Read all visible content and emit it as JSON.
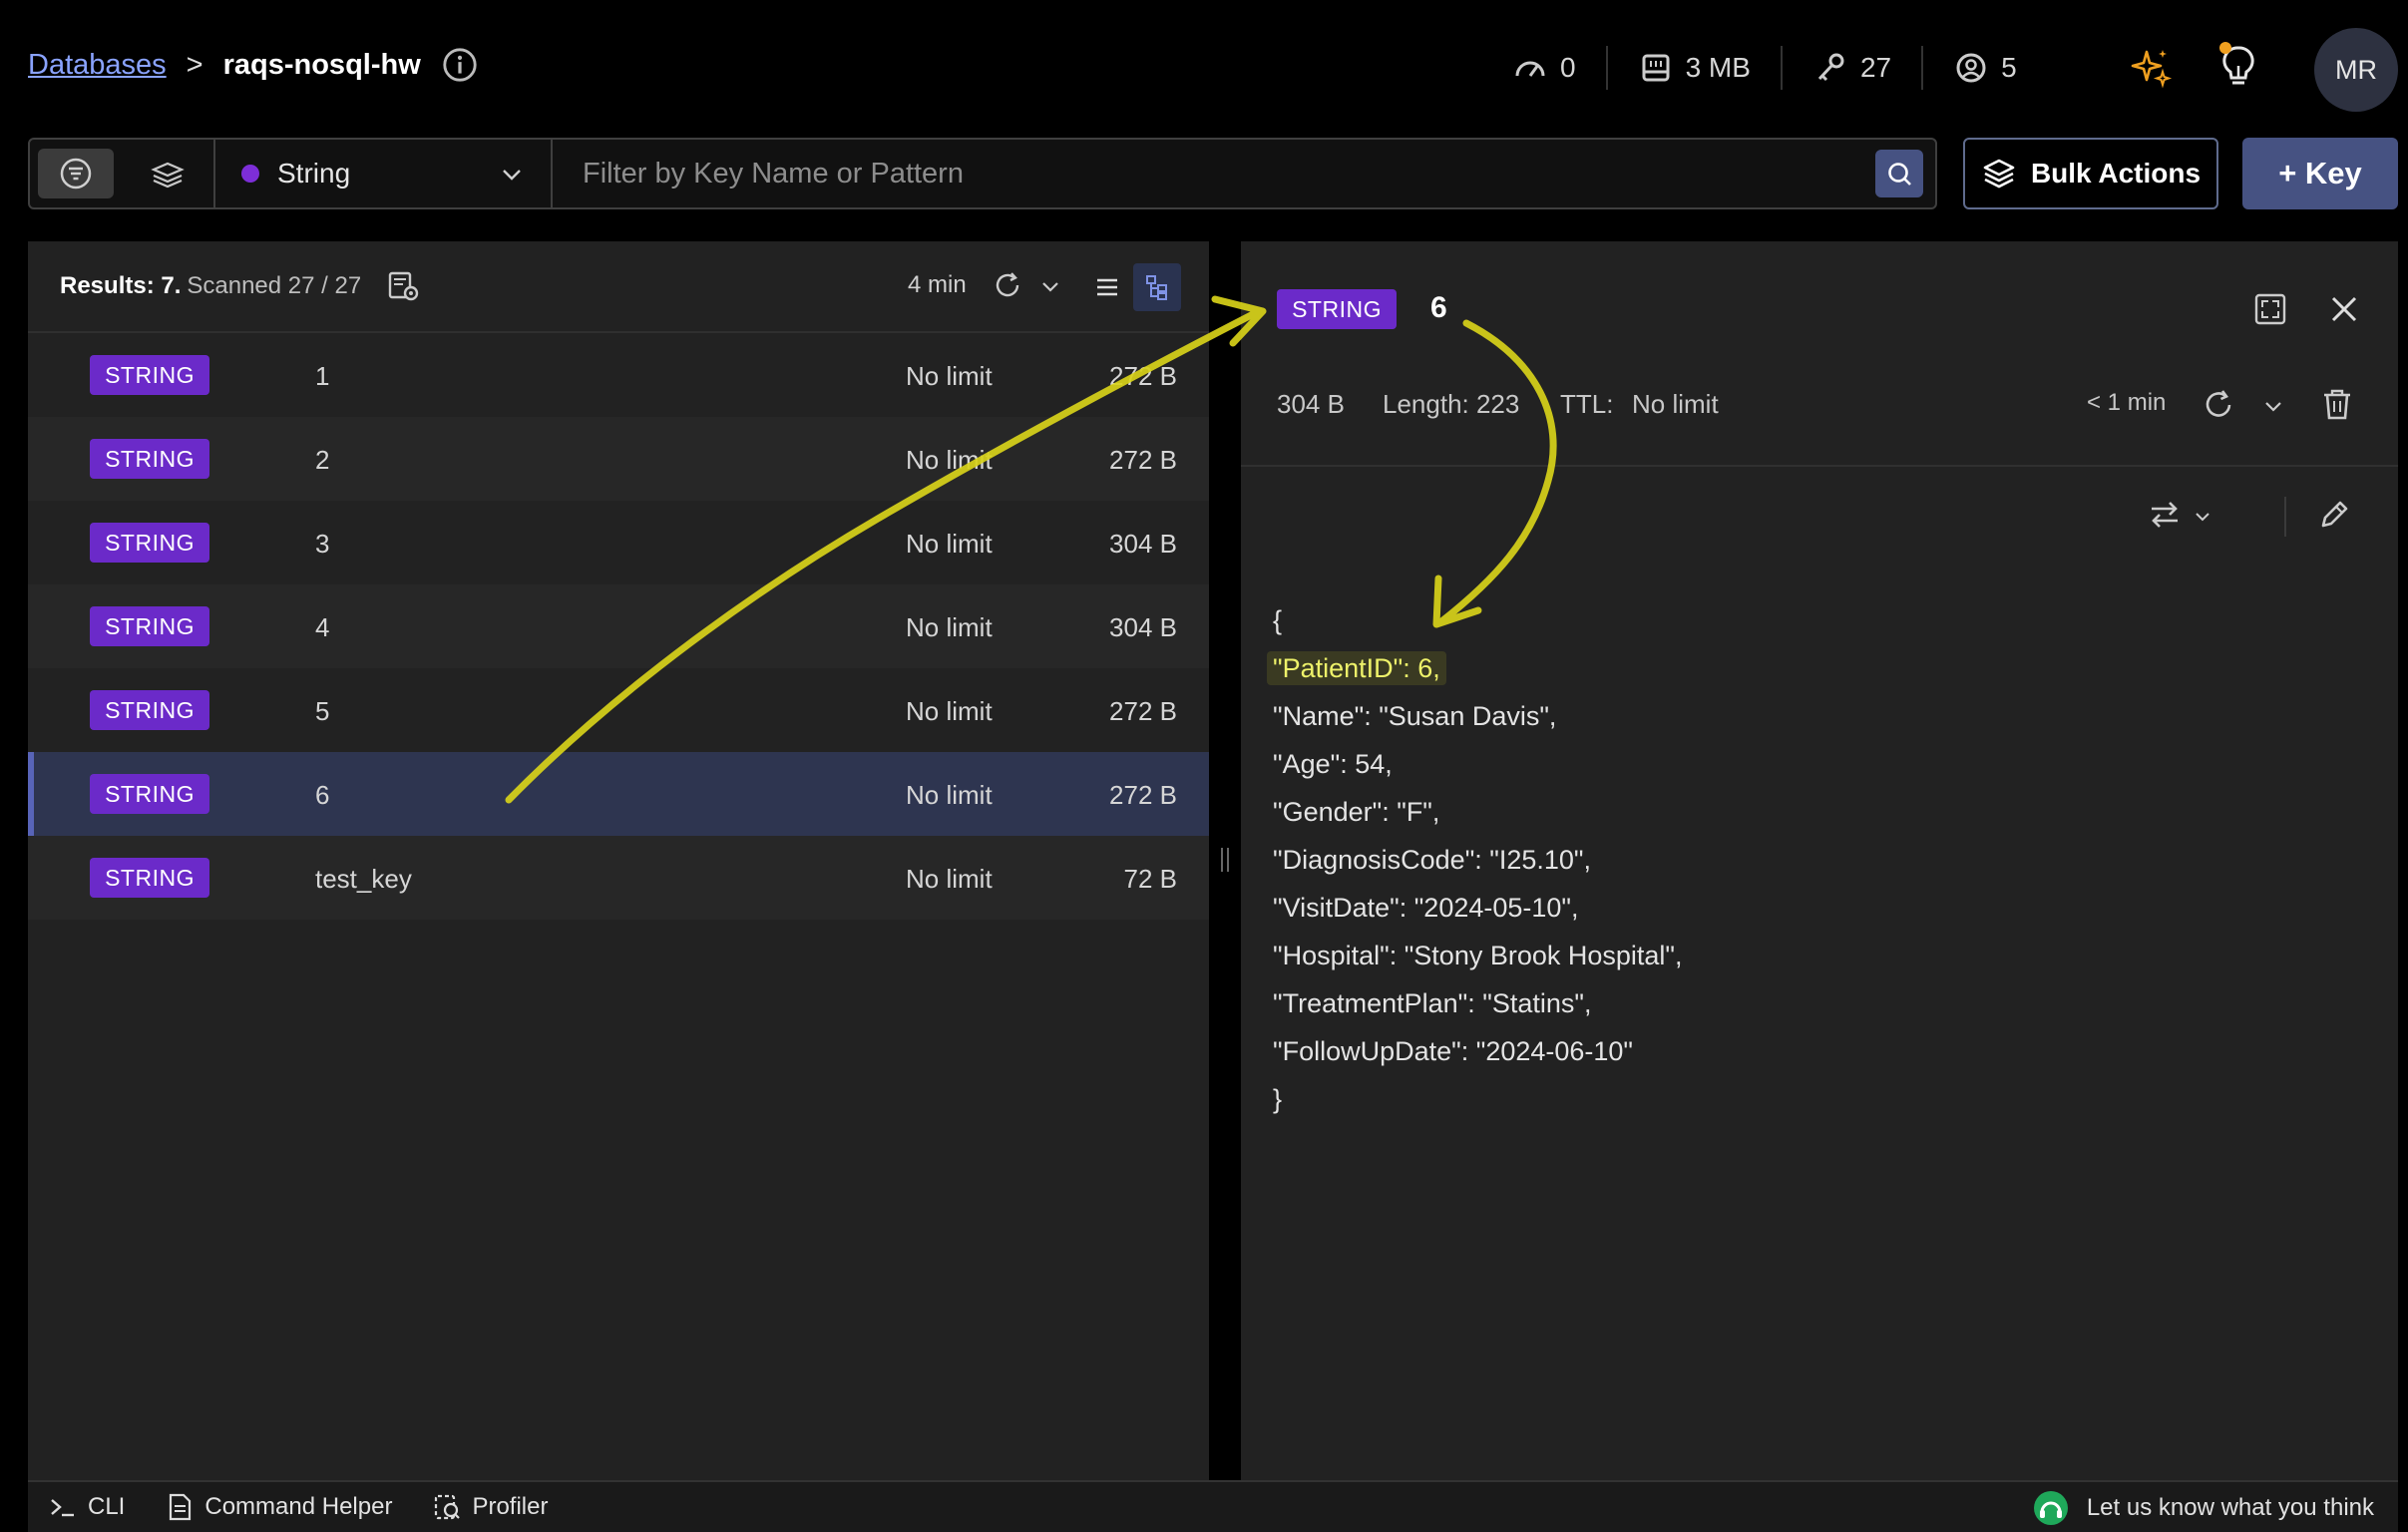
{
  "breadcrumb": {
    "link": "Databases",
    "separator": ">",
    "database": "raqs-nosql-hw"
  },
  "stats": {
    "ops": "0",
    "memory": "3 MB",
    "keys": "27",
    "clients": "5"
  },
  "user": {
    "initials": "MR"
  },
  "filter": {
    "type": "String",
    "search_placeholder": "Filter by Key Name or Pattern"
  },
  "actions": {
    "bulk": "Bulk Actions",
    "add_key": "+ Key"
  },
  "list": {
    "results_label": "Results: 7.",
    "scanned": "Scanned 27 / 27",
    "refresh_age": "4 min",
    "rows": [
      {
        "type": "STRING",
        "key": "1",
        "ttl": "No limit",
        "size": "272 B"
      },
      {
        "type": "STRING",
        "key": "2",
        "ttl": "No limit",
        "size": "272 B"
      },
      {
        "type": "STRING",
        "key": "3",
        "ttl": "No limit",
        "size": "304 B"
      },
      {
        "type": "STRING",
        "key": "4",
        "ttl": "No limit",
        "size": "304 B"
      },
      {
        "type": "STRING",
        "key": "5",
        "ttl": "No limit",
        "size": "272 B"
      },
      {
        "type": "STRING",
        "key": "6",
        "ttl": "No limit",
        "size": "272 B"
      },
      {
        "type": "STRING",
        "key": "test_key",
        "ttl": "No limit",
        "size": "72 B"
      }
    ]
  },
  "detail": {
    "type": "STRING",
    "key": "6",
    "size": "304 B",
    "length": "Length: 223",
    "ttl_label": "TTL:",
    "ttl_value": "No limit",
    "refresh_age": "< 1 min",
    "json_lines": [
      "{",
      "\"PatientID\": 6,",
      "\"Name\": \"Susan Davis\",",
      "\"Age\": 54,",
      "\"Gender\": \"F\",",
      "\"DiagnosisCode\": \"I25.10\",",
      "\"VisitDate\": \"2024-05-10\",",
      "\"Hospital\": \"Stony Brook Hospital\",",
      "\"TreatmentPlan\": \"Statins\",",
      "\"FollowUpDate\": \"2024-06-10\"",
      "}"
    ]
  },
  "bottom": {
    "cli": "CLI",
    "helper": "Command Helper",
    "profiler": "Profiler",
    "feedback": "Let us know what you think"
  },
  "colors": {
    "badge": "#6b2ac9",
    "accent": "#465282",
    "highlight": "#eef26a",
    "annotation": "#d8d21a"
  }
}
